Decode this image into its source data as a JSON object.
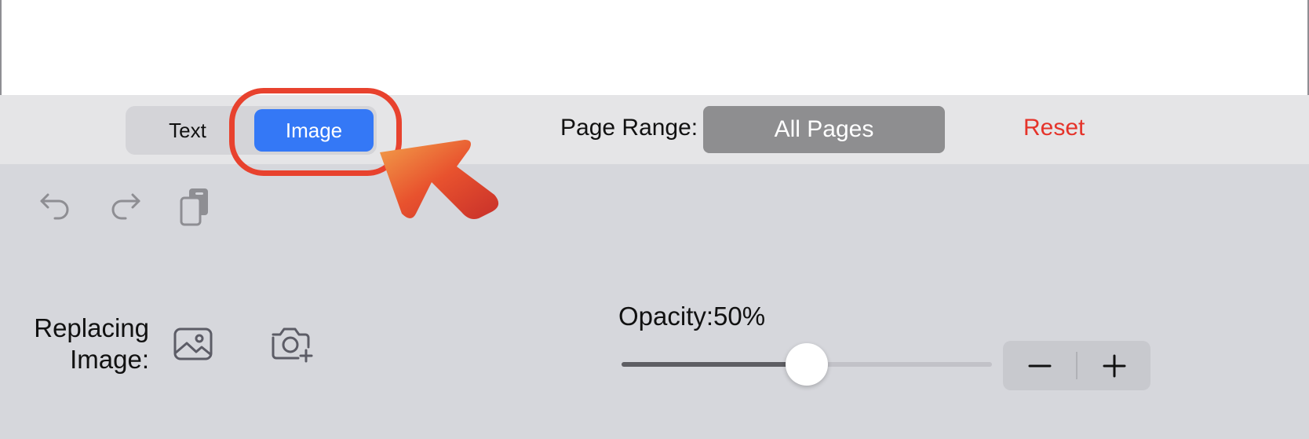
{
  "mode_selector": {
    "options": [
      "Text",
      "Image"
    ],
    "selected": "Image"
  },
  "page_range": {
    "label": "Page Range:",
    "value": "All Pages"
  },
  "reset_label": "Reset",
  "toolbar": {
    "icons": [
      "undo-icon",
      "redo-icon",
      "copy-icon"
    ]
  },
  "replacing_image": {
    "label_line1": "Replacing",
    "label_line2": "Image:",
    "icons": [
      "photo-library-icon",
      "camera-add-icon"
    ]
  },
  "opacity": {
    "label": "Opacity:",
    "value_text": "50%",
    "value": 0.5
  },
  "stepper": {
    "icons": [
      "minus-icon",
      "plus-icon"
    ]
  },
  "colors": {
    "accent": "#3478f6",
    "reset": "#e5332a",
    "annotation": "#e8422e",
    "panel": "#d6d7dc",
    "topbar": "#e5e5e7"
  }
}
